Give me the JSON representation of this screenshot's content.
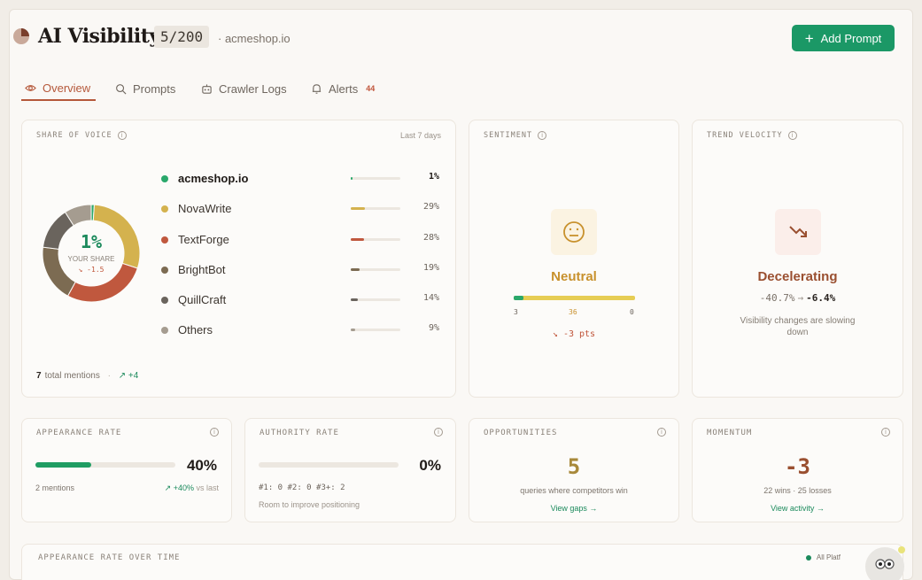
{
  "header": {
    "title": "AI Visibility",
    "count_badge": "5/200",
    "domain": "· acmeshop.io",
    "add_button": "Add Prompt"
  },
  "tabs": [
    {
      "label": "Overview",
      "icon": "eye-icon",
      "active": true
    },
    {
      "label": "Prompts",
      "icon": "search-icon"
    },
    {
      "label": "Crawler Logs",
      "icon": "robot-icon"
    },
    {
      "label": "Alerts",
      "icon": "bell-icon",
      "count": "44"
    }
  ],
  "share_of_voice": {
    "title": "SHARE OF VOICE",
    "period": "Last 7 days",
    "center_value": "1%",
    "center_label": "YOUR SHARE",
    "center_delta": "↘ -1.5",
    "legend": [
      {
        "name": "acmeshop.io",
        "pct": "1%",
        "value": 1,
        "color": "#2aa86b",
        "primary": true
      },
      {
        "name": "NovaWrite",
        "pct": "29%",
        "value": 29,
        "color": "#d4b24e"
      },
      {
        "name": "TextForge",
        "pct": "28%",
        "value": 28,
        "color": "#c0583e"
      },
      {
        "name": "BrightBot",
        "pct": "19%",
        "value": 19,
        "color": "#7c6b52"
      },
      {
        "name": "QuillCraft",
        "pct": "14%",
        "value": 14,
        "color": "#6a645d"
      },
      {
        "name": "Others",
        "pct": "9%",
        "value": 9,
        "color": "#a59c90"
      }
    ],
    "total_count": "7",
    "total_label": "total mentions",
    "total_delta": "↗ +4"
  },
  "sentiment": {
    "title": "SENTIMENT",
    "label": "Neutral",
    "positive": "3",
    "neutral": "36",
    "negative": "0",
    "positive_frac": 0.08,
    "delta": "↘ -3 pts",
    "icon": "neutral-face-icon",
    "accent": "#c8912d"
  },
  "trend_velocity": {
    "title": "TREND VELOCITY",
    "label": "Decelerating",
    "from": "-40.7%",
    "arrow": "→",
    "to": "-6.4%",
    "description": "Visibility changes are slowing down",
    "icon": "trending-down-icon",
    "accent": "#9a4f30"
  },
  "appearance_rate": {
    "title": "APPEARANCE RATE",
    "value": "40%",
    "fill_frac": 0.4,
    "mentions": "2 mentions",
    "delta": "↗ +40%",
    "delta_suffix": "vs last"
  },
  "authority_rate": {
    "title": "AUTHORITY RATE",
    "value": "0%",
    "fill_frac": 0,
    "positions": "#1: 0  #2: 0  #3+: 2",
    "note": "Room to improve positioning"
  },
  "opportunities": {
    "title": "OPPORTUNITIES",
    "value": "5",
    "description": "queries where competitors win",
    "link": "View gaps →",
    "color": "#a8893a"
  },
  "momentum": {
    "title": "MOMENTUM",
    "value": "-3",
    "description": "22 wins · 25 losses",
    "link": "View activity →",
    "color": "#9a4f30"
  },
  "appearance_over_time": {
    "title": "APPEARANCE RATE OVER TIME",
    "legend": "All Platf"
  }
}
